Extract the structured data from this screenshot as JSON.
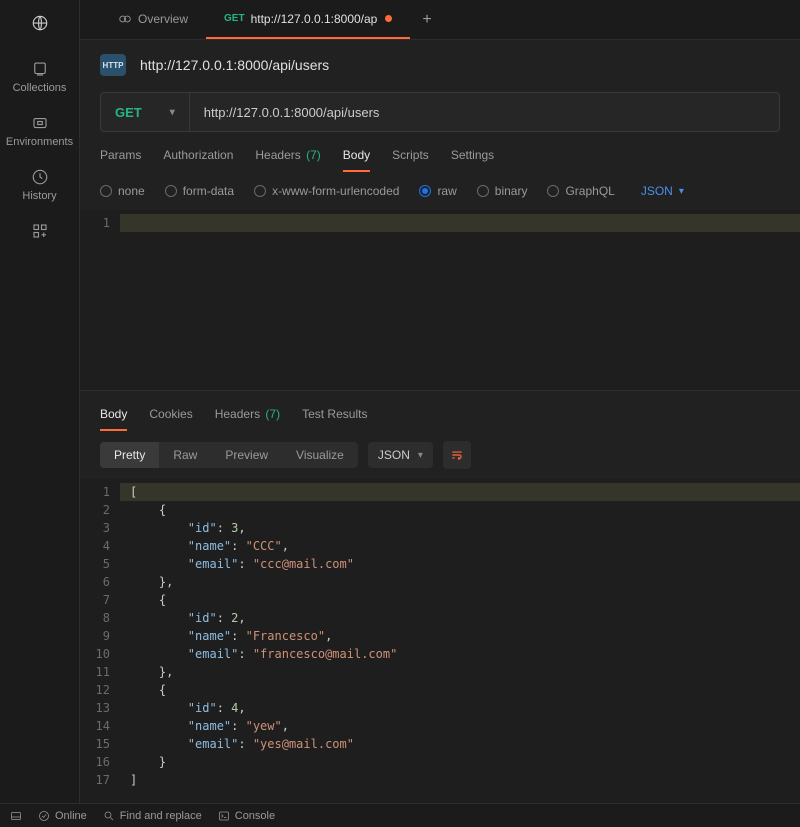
{
  "sidebar": {
    "items": [
      {
        "label": "Collections"
      },
      {
        "label": "Environments"
      },
      {
        "label": "History"
      }
    ]
  },
  "tabs": {
    "items": [
      {
        "label": "Overview"
      },
      {
        "method": "GET",
        "label": "http://127.0.0.1:8000/ap",
        "unsaved": true
      }
    ]
  },
  "request": {
    "badge": "HTTP",
    "title": "http://127.0.0.1:8000/api/users",
    "method": "GET",
    "url": "http://127.0.0.1:8000/api/users",
    "section_tabs": {
      "params": "Params",
      "authorization": "Authorization",
      "headers_label": "Headers",
      "headers_count": "(7)",
      "body": "Body",
      "scripts": "Scripts",
      "settings": "Settings"
    },
    "body_types": {
      "none": "none",
      "form_data": "form-data",
      "xwww": "x-www-form-urlencoded",
      "raw": "raw",
      "binary": "binary",
      "graphql": "GraphQL",
      "format": "JSON"
    },
    "body_editor_lines": [
      "1"
    ]
  },
  "response": {
    "section_tabs": {
      "body": "Body",
      "cookies": "Cookies",
      "headers_label": "Headers",
      "headers_count": "(7)",
      "test_results": "Test Results"
    },
    "view_buttons": {
      "pretty": "Pretty",
      "raw": "Raw",
      "preview": "Preview",
      "visualize": "Visualize"
    },
    "lang": "JSON",
    "line_numbers": [
      "1",
      "2",
      "3",
      "4",
      "5",
      "6",
      "7",
      "8",
      "9",
      "10",
      "11",
      "12",
      "13",
      "14",
      "15",
      "16",
      "17"
    ],
    "json_body": [
      {
        "id": 3,
        "name": "CCC",
        "email": "ccc@mail.com"
      },
      {
        "id": 2,
        "name": "Francesco",
        "email": "francesco@mail.com"
      },
      {
        "id": 4,
        "name": "yew",
        "email": "yes@mail.com"
      }
    ]
  },
  "statusbar": {
    "online": "Online",
    "find": "Find and replace",
    "console": "Console"
  }
}
